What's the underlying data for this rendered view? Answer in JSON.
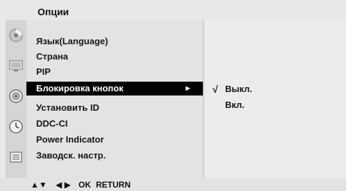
{
  "menu": {
    "title": "Опции",
    "items": [
      {
        "label": "Язык(Language)"
      },
      {
        "label": "Страна"
      },
      {
        "label": "PIP"
      },
      {
        "label": "Блокировка кнопок",
        "arrow": "►"
      },
      {
        "label": "Установить ID"
      },
      {
        "label": "DDC-CI"
      },
      {
        "label": "Power Indicator"
      },
      {
        "label": "Заводск. настр."
      }
    ],
    "selected_index": 3
  },
  "submenu": {
    "options": [
      {
        "label": "Выкл.",
        "check": "√"
      },
      {
        "label": "Вкл."
      }
    ],
    "checked_index": 0
  },
  "icons": [
    {
      "name": "picture-icon"
    },
    {
      "name": "screen-icon"
    },
    {
      "name": "sound-icon"
    },
    {
      "name": "time-icon"
    },
    {
      "name": "options-icon"
    }
  ],
  "footer": {
    "up_down": "▲▼",
    "left_right": "◀ ▶",
    "ok": "OK",
    "return": "RETURN"
  },
  "colors": {
    "highlight_bg": "#000000",
    "highlight_text": "#ffffff"
  }
}
